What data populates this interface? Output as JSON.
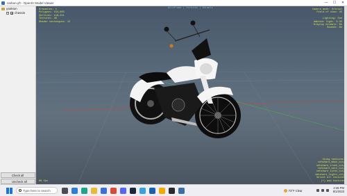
{
  "window": {
    "title": "carbon.yft - OpenIV Model Viewer",
    "controls": {
      "minimize": "—",
      "maximize": "☐",
      "close": "✕"
    }
  },
  "sidebar": {
    "root_label": "yankton",
    "child_label": "chassis",
    "child_checked": "✔",
    "expander": "+",
    "check_all": "Check all",
    "uncheck_all": "Uncheck all",
    "bottom_toggle": "Use Lodding"
  },
  "viewport": {
    "top_center": "Wireframe | Textures | Normals",
    "stats_left": "Drawables: 1\nPolygons: 154,803\nVertices: 119,211\nTextures: 48\nShader techniques: 12",
    "stats_right": "Camera mode: Orbital\nField of view: 45\n\nLighting: Sun\nAmbient light: 0.35\nDisplay normals: No\nBounds: No",
    "bottom_right": "Using textures:\nvehshare_mhcz_city\nvehshare_truck_city\nvehshare_worn_city\nvehshare_tyres_city\nvehshare_lights_city\nSelect all textures\n(+) add textures",
    "fps": "60 fps"
  },
  "taskbar": {
    "search_placeholder": "Type here to search",
    "weather": "73°F Clear",
    "time": "2:46 PM",
    "date": "6/1/2023"
  },
  "colors": {
    "viewport_top": "#48586a",
    "viewport_bottom": "#4a5561",
    "overlay_yellow": "#d9e64a",
    "overlay_blue": "#6fb4e8",
    "bike_body": "#f4f4f4",
    "bike_frame": "#141414"
  }
}
